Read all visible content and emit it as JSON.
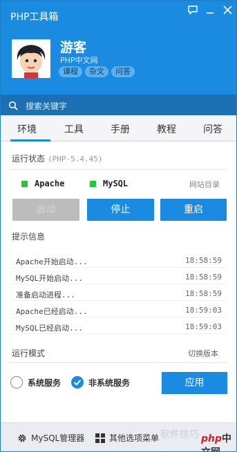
{
  "window": {
    "title": "PHP工具箱",
    "controls": {
      "chat": "chat-icon",
      "minimize": "minimize-icon",
      "close": "close-icon"
    }
  },
  "user": {
    "name": "游客",
    "subtitle": "PHP中文网",
    "tags": [
      "课程",
      "杂文",
      "问答"
    ]
  },
  "search": {
    "placeholder": "搜索关键字"
  },
  "tabs": [
    {
      "label": "环境",
      "active": true
    },
    {
      "label": "工具",
      "active": false
    },
    {
      "label": "手册",
      "active": false
    },
    {
      "label": "教程",
      "active": false
    },
    {
      "label": "问答",
      "active": false
    }
  ],
  "status": {
    "title": "运行状态",
    "php_version": "(PHP-5.4.45)",
    "services": [
      {
        "name": "Apache",
        "color": "#25c43b"
      },
      {
        "name": "MySQL",
        "color": "#25c43b"
      }
    ],
    "site_dir": "网站目录"
  },
  "buttons": {
    "start": "启动",
    "stop": "停止",
    "restart": "重启"
  },
  "log": {
    "title": "提示信息",
    "rows": [
      {
        "msg": "Apache开始启动...",
        "time": "18:58:59"
      },
      {
        "msg": "MySQL开始启动...",
        "time": "18:58:59"
      },
      {
        "msg": "准备启动进程...",
        "time": "18:58:59"
      },
      {
        "msg": "Apache已经启动...",
        "time": "18:59:03"
      },
      {
        "msg": "MySQL已经启动...",
        "time": "18:59:03"
      }
    ]
  },
  "mode": {
    "title": "运行模式",
    "switch_version": "切换版本",
    "options": [
      {
        "label": "系统服务",
        "selected": false
      },
      {
        "label": "非系统服务",
        "selected": true
      }
    ],
    "apply": "应用"
  },
  "footer": {
    "mysql_manager": "MySQL管理器",
    "more_menu": "其他选项菜单",
    "watermark": "软件技巧",
    "logo_php": "php",
    "logo_cn": "中文网"
  },
  "colors": {
    "accent": "#1a8be0",
    "header_dark": "#1b6fb2",
    "status_green": "#25c43b"
  }
}
